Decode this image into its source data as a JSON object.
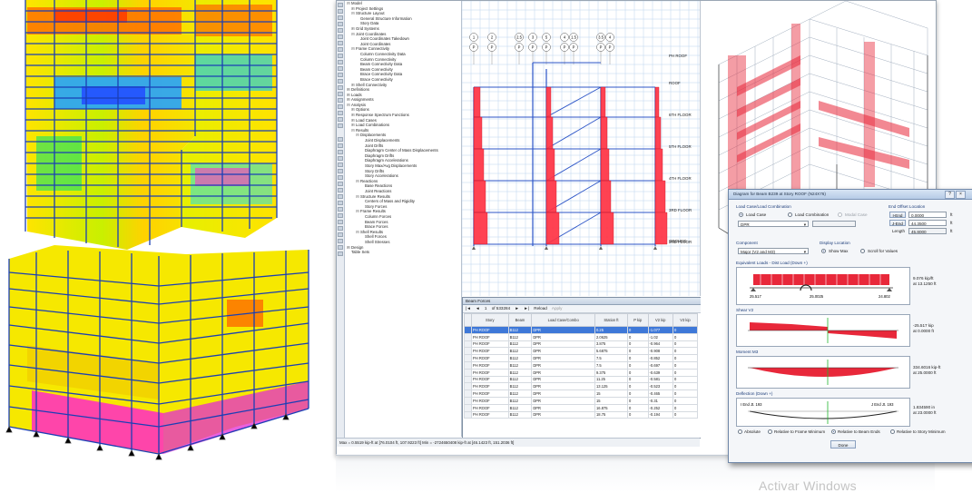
{
  "model_tree": {
    "items": [
      {
        "depth": 0,
        "toggle": "⊟",
        "label": "Model"
      },
      {
        "depth": 1,
        "toggle": "⊞",
        "label": "Project Settings"
      },
      {
        "depth": 1,
        "toggle": "⊟",
        "label": "Structure Layout"
      },
      {
        "depth": 2,
        "toggle": "",
        "label": "General Structure Information"
      },
      {
        "depth": 2,
        "toggle": "",
        "label": "Story Data"
      },
      {
        "depth": 1,
        "toggle": "⊞",
        "label": "Grid Systems"
      },
      {
        "depth": 1,
        "toggle": "⊟",
        "label": "Joint Coordinates"
      },
      {
        "depth": 2,
        "toggle": "",
        "label": "Joint Coordinates Takedown"
      },
      {
        "depth": 2,
        "toggle": "",
        "label": "Joint Coordinates"
      },
      {
        "depth": 1,
        "toggle": "⊟",
        "label": "Frame Connectivity"
      },
      {
        "depth": 2,
        "toggle": "",
        "label": "Column Connectivity Data"
      },
      {
        "depth": 2,
        "toggle": "",
        "label": "Column Connectivity"
      },
      {
        "depth": 2,
        "toggle": "",
        "label": "Beam Connectivity Data"
      },
      {
        "depth": 2,
        "toggle": "",
        "label": "Beam Connectivity"
      },
      {
        "depth": 2,
        "toggle": "",
        "label": "Brace Connectivity Data"
      },
      {
        "depth": 2,
        "toggle": "",
        "label": "Brace Connectivity"
      },
      {
        "depth": 1,
        "toggle": "⊞",
        "label": "Shell Connectivity"
      },
      {
        "depth": 0,
        "toggle": "⊞",
        "label": "Definitions"
      },
      {
        "depth": 0,
        "toggle": "⊞",
        "label": "Loads"
      },
      {
        "depth": 0,
        "toggle": "⊞",
        "label": "Assignments"
      },
      {
        "depth": 0,
        "toggle": "⊟",
        "label": "Analysis"
      },
      {
        "depth": 1,
        "toggle": "⊞",
        "label": "Options"
      },
      {
        "depth": 1,
        "toggle": "⊞",
        "label": "Response Spectrum Functions"
      },
      {
        "depth": 1,
        "toggle": "⊞",
        "label": "Load Cases"
      },
      {
        "depth": 1,
        "toggle": "⊞",
        "label": "Load Combinations"
      },
      {
        "depth": 1,
        "toggle": "⊟",
        "label": "Results"
      },
      {
        "depth": 2,
        "toggle": "⊟",
        "label": "Displacements"
      },
      {
        "depth": 3,
        "toggle": "",
        "label": "Joint Displacements"
      },
      {
        "depth": 3,
        "toggle": "",
        "label": "Joint Drifts"
      },
      {
        "depth": 3,
        "toggle": "",
        "label": "Diaphragm Center of Mass Displacements"
      },
      {
        "depth": 3,
        "toggle": "",
        "label": "Diaphragm Drifts"
      },
      {
        "depth": 3,
        "toggle": "",
        "label": "Diaphragm Accelerations"
      },
      {
        "depth": 3,
        "toggle": "",
        "label": "Story Max/Avg Displacements"
      },
      {
        "depth": 3,
        "toggle": "",
        "label": "Story Drifts"
      },
      {
        "depth": 3,
        "toggle": "",
        "label": "Story Accelerations"
      },
      {
        "depth": 2,
        "toggle": "⊟",
        "label": "Reactions"
      },
      {
        "depth": 3,
        "toggle": "",
        "label": "Base Reactions"
      },
      {
        "depth": 3,
        "toggle": "",
        "label": "Joint Reactions"
      },
      {
        "depth": 2,
        "toggle": "⊟",
        "label": "Structure Results"
      },
      {
        "depth": 3,
        "toggle": "",
        "label": "Centers of Mass and Rigidity"
      },
      {
        "depth": 3,
        "toggle": "",
        "label": "Story Forces"
      },
      {
        "depth": 2,
        "toggle": "⊟",
        "label": "Frame Results"
      },
      {
        "depth": 3,
        "toggle": "",
        "label": "Column Forces"
      },
      {
        "depth": 3,
        "toggle": "",
        "label": "Beam Forces"
      },
      {
        "depth": 3,
        "toggle": "",
        "label": "Brace Forces"
      },
      {
        "depth": 2,
        "toggle": "⊟",
        "label": "Shell Results"
      },
      {
        "depth": 3,
        "toggle": "",
        "label": "Shell Forces"
      },
      {
        "depth": 3,
        "toggle": "",
        "label": "Shell Stresses"
      },
      {
        "depth": 0,
        "toggle": "⊞",
        "label": "Design"
      },
      {
        "depth": 0,
        "toggle": "",
        "label": "Table Sets"
      }
    ]
  },
  "elevation": {
    "grid_bubbles": [
      {
        "top": "1",
        "bottom": "P"
      },
      {
        "top": "2",
        "bottom": "P"
      },
      {
        "top": "2.5",
        "bottom": "P"
      },
      {
        "top": "3",
        "bottom": "P"
      },
      {
        "top": "5",
        "bottom": "P"
      },
      {
        "top": "4",
        "bottom": "P"
      },
      {
        "top": "1.5",
        "bottom": "P"
      },
      {
        "top": "3.5",
        "bottom": "P"
      },
      {
        "top": "4",
        "bottom": "P"
      }
    ],
    "story_labels": [
      "PH ROOF",
      "ROOF",
      "6TH FLOOR",
      "5TH FLOOR",
      "4TH FLOOR",
      "3RD FLOOR",
      "2ND FLOOR",
      "GROUND"
    ]
  },
  "beam_forces": {
    "title": "Beam Forces",
    "nav": {
      "first": "|◄",
      "prev": "◄",
      "page": "1",
      "of": "of 533284",
      "next": "►",
      "last": "►|",
      "reload": "Reload",
      "apply": "Apply"
    },
    "columns": [
      "Story",
      "Beam",
      "Load Case/Combo",
      "Station ft",
      "P kip",
      "V2 kip",
      "V3 kip"
    ],
    "rows": [
      [
        "PH ROOF",
        "B112",
        "DPR",
        "0.25",
        "0",
        "-1.077",
        "0"
      ],
      [
        "PH ROOF",
        "B112",
        "DPR",
        "2.0625",
        "0",
        "-1.02",
        "0"
      ],
      [
        "PH ROOF",
        "B112",
        "DPR",
        "3.875",
        "0",
        "-0.964",
        "0"
      ],
      [
        "PH ROOF",
        "B112",
        "DPR",
        "5.6875",
        "0",
        "-0.908",
        "0"
      ],
      [
        "PH ROOF",
        "B112",
        "DPR",
        "7.5",
        "0",
        "-0.852",
        "0"
      ],
      [
        "PH ROOF",
        "B112",
        "DPR",
        "7.5",
        "0",
        "-0.697",
        "0"
      ],
      [
        "PH ROOF",
        "B112",
        "DPR",
        "9.375",
        "0",
        "-0.639",
        "0"
      ],
      [
        "PH ROOF",
        "B112",
        "DPR",
        "11.25",
        "0",
        "-0.581",
        "0"
      ],
      [
        "PH ROOF",
        "B112",
        "DPR",
        "13.125",
        "0",
        "-0.523",
        "0"
      ],
      [
        "PH ROOF",
        "B112",
        "DPR",
        "15",
        "0",
        "-0.465",
        "0"
      ],
      [
        "PH ROOF",
        "B112",
        "DPR",
        "15",
        "0",
        "-0.31",
        "0"
      ],
      [
        "PH ROOF",
        "B112",
        "DPR",
        "16.875",
        "0",
        "-0.252",
        "0"
      ],
      [
        "PH ROOF",
        "B112",
        "DPR",
        "18.75",
        "0",
        "-0.194",
        "0"
      ]
    ]
  },
  "status_bar": "Max = 0.5519 kip-ft at [76.0104 ft, 107.9223 ft]   Min = -2724650408 kip-ft at [46.1423 ft, 151.2036 ft]",
  "dialog": {
    "title": "Diagram for Beam B239 at Story ROOF (N24X76)",
    "load_case_group": "Load Case/Load Combination",
    "radio_load_case": "Load Case",
    "radio_load_combination": "Load Combination",
    "radio_modal_case": "Modal Case",
    "load_case_value": "DPR",
    "end_offset_group": "End Offset Location",
    "i_end_label": "I-End",
    "i_end_value": "0.0000",
    "j_end_label": "J-End",
    "j_end_value": "44.3500",
    "length_label": "Length",
    "length_value": "45.8000",
    "unit_ft": "ft",
    "component_label": "Component",
    "component_value": "Major (V2 and M3)",
    "display_location_label": "Display Location",
    "show_max": "Show Max",
    "scroll_values": "Scroll for Values",
    "equivalent_loads_label": "Equivalent Loads - Dist Load (Down +)",
    "eq_left": "25.517",
    "eq_mid": "25.0025",
    "eq_right": "24.802",
    "eq_value": "9.076 kip/ft",
    "eq_at": "at 13.1250 ft",
    "shear_label": "Shear V2",
    "shear_value": "-25.517 kip",
    "shear_at": "at 0.0000 ft",
    "moment_label": "Moment M3",
    "moment_value": "334.6016 kip-ft",
    "moment_at": "at 25.0000 ft",
    "deflection_label": "Deflection (Down +)",
    "defl_i_end": "I End Jt. 193",
    "defl_j_end": "J End Jt. 193",
    "defl_value": "1.834590 in",
    "defl_at": "at 23.0000 ft",
    "opt_absolute": "Absolute",
    "opt_rel_frame_min": "Relative to Frame Minimum",
    "opt_rel_beam_ends": "Relative to Beam Ends",
    "opt_rel_story_min": "Relative to Story Minimum",
    "done": "Done"
  },
  "watermark": "Activar Windows"
}
